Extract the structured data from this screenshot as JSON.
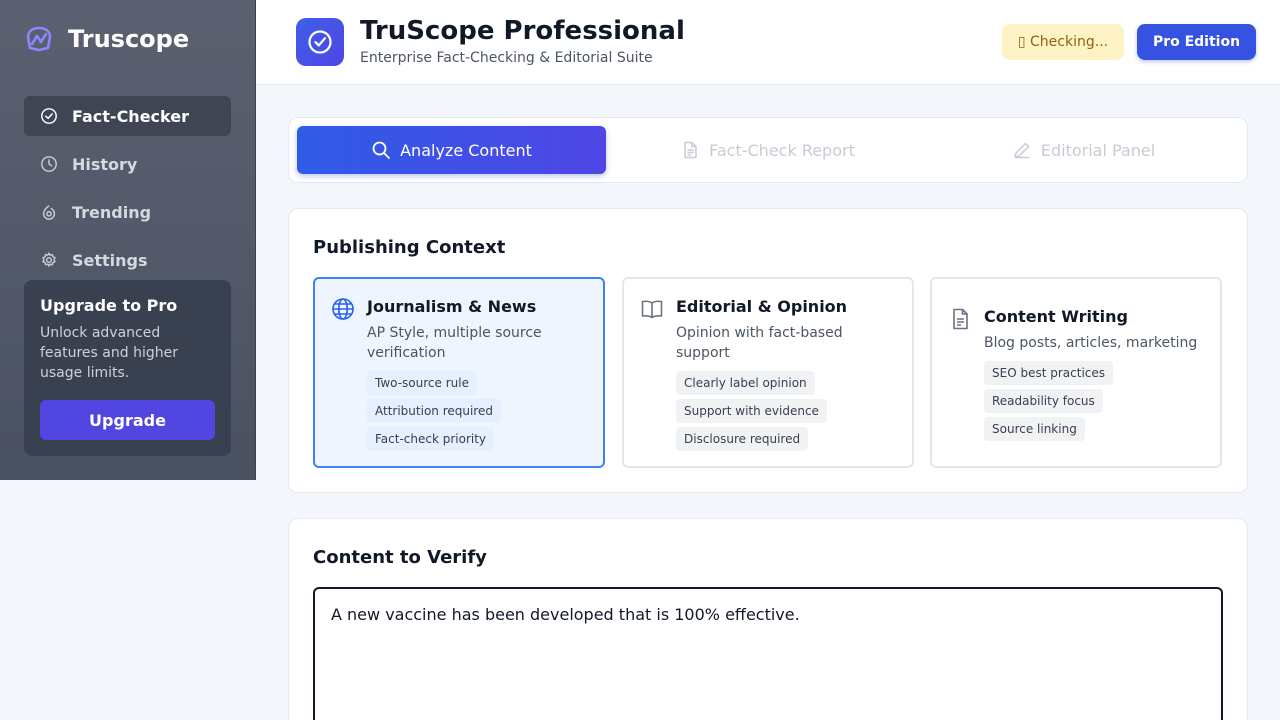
{
  "brand": {
    "name": "Truscope"
  },
  "sidebar": {
    "items": [
      {
        "label": "Fact-Checker",
        "icon": "check-circle-icon",
        "active": true
      },
      {
        "label": "History",
        "icon": "clock-icon",
        "active": false
      },
      {
        "label": "Trending",
        "icon": "trending-icon",
        "active": false
      },
      {
        "label": "Settings",
        "icon": "gear-icon",
        "active": false
      }
    ],
    "upgrade": {
      "title": "Upgrade to Pro",
      "text": "Unlock advanced features and higher usage limits.",
      "button": "Upgrade"
    }
  },
  "header": {
    "title": "TruScope Professional",
    "subtitle": "Enterprise Fact-Checking & Editorial Suite",
    "status": "▯ Checking...",
    "edition": "Pro Edition"
  },
  "tabs": [
    {
      "label": "Analyze Content",
      "icon": "search-icon",
      "active": true
    },
    {
      "label": "Fact-Check Report",
      "icon": "document-icon",
      "active": false
    },
    {
      "label": "Editorial Panel",
      "icon": "pencil-icon",
      "active": false
    }
  ],
  "context": {
    "title": "Publishing Context",
    "options": [
      {
        "title": "Journalism & News",
        "description": "AP Style, multiple source verification",
        "tags": [
          "Two-source rule",
          "Attribution required",
          "Fact-check priority"
        ],
        "icon": "globe-icon",
        "selected": true
      },
      {
        "title": "Editorial & Opinion",
        "description": "Opinion with fact-based support",
        "tags": [
          "Clearly label opinion",
          "Support with evidence",
          "Disclosure required"
        ],
        "icon": "book-icon",
        "selected": false
      },
      {
        "title": "Content Writing",
        "description": "Blog posts, articles, marketing",
        "tags": [
          "SEO best practices",
          "Readability focus",
          "Source linking"
        ],
        "icon": "file-text-icon",
        "selected": false
      }
    ]
  },
  "content": {
    "title": "Content to Verify",
    "value": "A new vaccine has been developed that is 100% effective."
  },
  "colors": {
    "accent": "#4f46e5",
    "primary": "#3552e3",
    "selected_border": "#3b82f6",
    "status_bg": "#fdf3c4"
  }
}
